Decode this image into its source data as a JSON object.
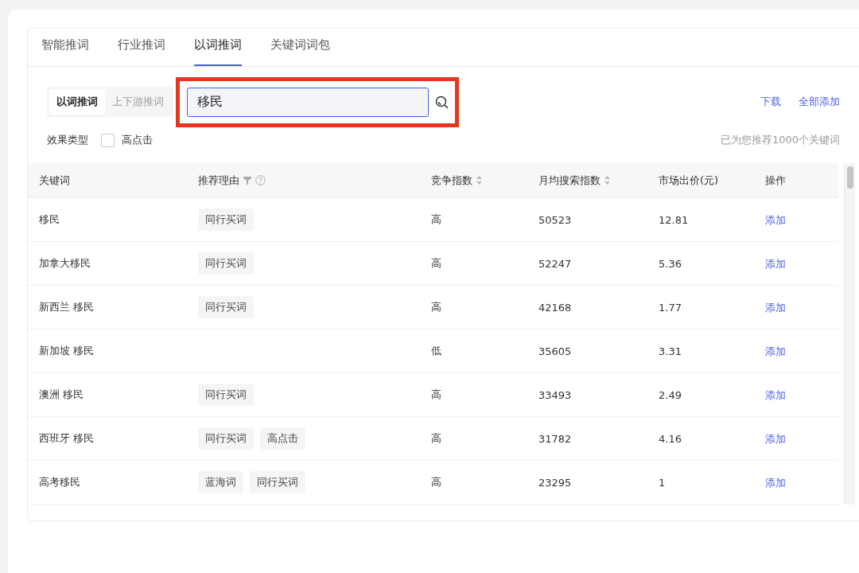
{
  "tabs": [
    {
      "label": "智能推词",
      "selected": false
    },
    {
      "label": "行业推词",
      "selected": false
    },
    {
      "label": "以词推词",
      "selected": true
    },
    {
      "label": "关键词词包",
      "selected": false
    }
  ],
  "modes": [
    {
      "label": "以词推词",
      "selected": true
    },
    {
      "label": "上下游推词",
      "selected": false
    }
  ],
  "search": {
    "value": "移民",
    "highlighted": true
  },
  "actions": [
    "下载",
    "全部添加"
  ],
  "filter": {
    "label": "效果类型",
    "option": {
      "label": "高点击",
      "checked": false
    }
  },
  "summary": "已为您推荐1000个关键词",
  "table": {
    "columns": [
      {
        "label": "关键词",
        "kind": "plain"
      },
      {
        "label": "推荐理由",
        "kind": "filter"
      },
      {
        "label": "竞争指数",
        "kind": "sort"
      },
      {
        "label": "月均搜索指数",
        "kind": "sort"
      },
      {
        "label": "市场出价(元)",
        "kind": "plain"
      },
      {
        "label": "操作",
        "kind": "plain"
      }
    ],
    "rows": [
      {
        "keyword": "移民",
        "tags": [
          "同行买词"
        ],
        "competition": "高",
        "searches": "50523",
        "price": "12.81",
        "action": "添加"
      },
      {
        "keyword": "加拿大移民",
        "tags": [
          "同行买词"
        ],
        "competition": "高",
        "searches": "52247",
        "price": "5.36",
        "action": "添加"
      },
      {
        "keyword": "新西兰 移民",
        "tags": [
          "同行买词"
        ],
        "competition": "高",
        "searches": "42168",
        "price": "1.77",
        "action": "添加"
      },
      {
        "keyword": "新加坡 移民",
        "tags": [],
        "competition": "低",
        "searches": "35605",
        "price": "3.31",
        "action": "添加"
      },
      {
        "keyword": "澳洲 移民",
        "tags": [
          "同行买词"
        ],
        "competition": "高",
        "searches": "33493",
        "price": "2.49",
        "action": "添加"
      },
      {
        "keyword": "西班牙 移民",
        "tags": [
          "同行买词",
          "高点击"
        ],
        "competition": "高",
        "searches": "31782",
        "price": "4.16",
        "action": "添加"
      },
      {
        "keyword": "高考移民",
        "tags": [
          "蓝海词",
          "同行买词"
        ],
        "competition": "高",
        "searches": "23295",
        "price": "1",
        "action": "添加"
      }
    ]
  }
}
